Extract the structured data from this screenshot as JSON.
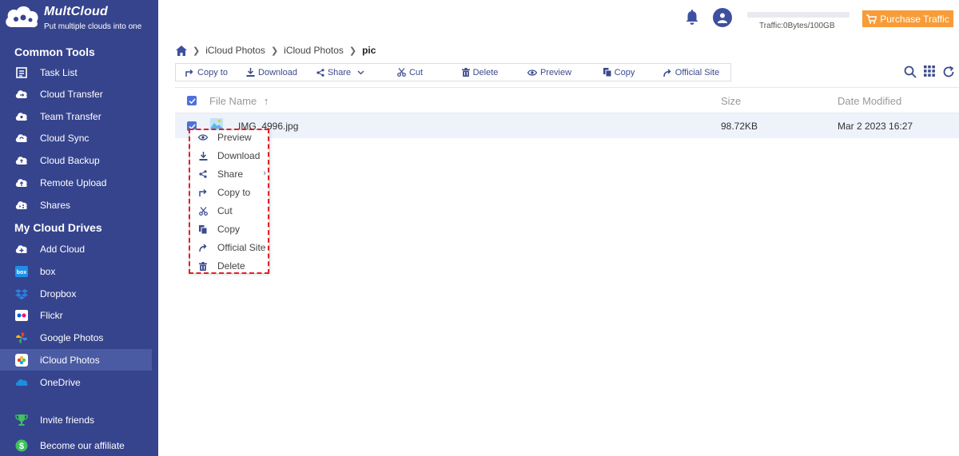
{
  "logo": {
    "title": "MultCloud",
    "subtitle": "Put multiple clouds into one"
  },
  "sidebar": {
    "common_tools_title": "Common Tools",
    "common_tools": [
      {
        "label": "Task List",
        "icon": "task-list-icon"
      },
      {
        "label": "Cloud Transfer",
        "icon": "cloud-transfer-icon"
      },
      {
        "label": "Team Transfer",
        "icon": "team-transfer-icon"
      },
      {
        "label": "Cloud Sync",
        "icon": "cloud-sync-icon"
      },
      {
        "label": "Cloud Backup",
        "icon": "cloud-backup-icon"
      },
      {
        "label": "Remote Upload",
        "icon": "remote-upload-icon"
      },
      {
        "label": "Shares",
        "icon": "shares-icon"
      }
    ],
    "my_drives_title": "My Cloud Drives",
    "drives": [
      {
        "label": "Add Cloud",
        "icon": "add-cloud-icon"
      },
      {
        "label": "box",
        "icon": "box-icon"
      },
      {
        "label": "Dropbox",
        "icon": "dropbox-icon"
      },
      {
        "label": "Flickr",
        "icon": "flickr-icon"
      },
      {
        "label": "Google Photos",
        "icon": "google-photos-icon"
      },
      {
        "label": "iCloud Photos",
        "icon": "icloud-photos-icon",
        "active": true
      },
      {
        "label": "OneDrive",
        "icon": "onedrive-icon"
      }
    ],
    "bottom": [
      {
        "label": "Invite friends",
        "icon": "trophy-icon"
      },
      {
        "label": "Become our affiliate",
        "icon": "dollar-icon"
      }
    ]
  },
  "topbar": {
    "traffic_text": "Traffic:0Bytes/100GB",
    "traffic_used_fraction": 0,
    "purchase_label": "Purchase Traffic"
  },
  "breadcrumb": [
    "iCloud Photos",
    "iCloud Photos",
    "pic"
  ],
  "toolbar": {
    "copy_to": "Copy to",
    "download": "Download",
    "share": "Share",
    "cut": "Cut",
    "delete": "Delete",
    "preview": "Preview",
    "copy": "Copy",
    "official_site": "Official Site"
  },
  "table": {
    "headers": {
      "name": "File Name",
      "name_sort": "↑",
      "size": "Size",
      "date": "Date Modified"
    },
    "rows": [
      {
        "name": "IMG_4996.jpg",
        "size": "98.72KB",
        "date": "Mar 2 2023 16:27",
        "selected": true
      }
    ]
  },
  "context_menu": [
    {
      "label": "Preview",
      "icon": "eye-icon"
    },
    {
      "label": "Download",
      "icon": "download-icon"
    },
    {
      "label": "Share",
      "icon": "share-icon",
      "submenu": "›"
    },
    {
      "label": "Copy to",
      "icon": "copy-to-icon"
    },
    {
      "label": "Cut",
      "icon": "scissors-icon"
    },
    {
      "label": "Copy",
      "icon": "copy-icon"
    },
    {
      "label": "Official Site",
      "icon": "official-site-icon"
    },
    {
      "label": "Delete",
      "icon": "trash-icon"
    }
  ],
  "colors": {
    "sidebar_bg": "#36448e",
    "accent": "#3b4a8c",
    "purchase": "#f79c38",
    "highlight_outline": "#e0202a",
    "row_selected": "#eef2fb"
  }
}
